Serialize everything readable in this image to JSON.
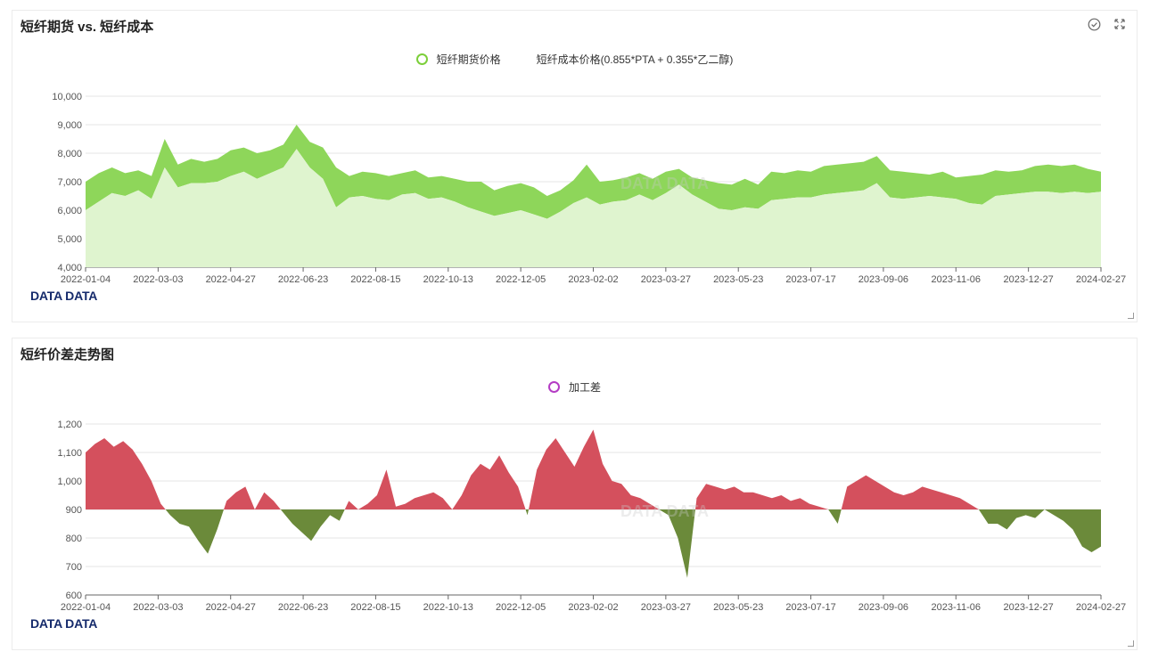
{
  "brand": "DATA DATA",
  "watermark": "DATA DATA",
  "panel1": {
    "title": "短纤期货 vs. 短纤成本",
    "legend": [
      "短纤期货价格",
      "短纤成本价格(0.855*PTA + 0.355*乙二醇)"
    ]
  },
  "panel2": {
    "title": "短纤价差走势图",
    "legend": [
      "加工差"
    ]
  },
  "chart_data": [
    {
      "type": "area",
      "title": "短纤期货 vs. 短纤成本",
      "ylim": [
        4000,
        10000
      ],
      "yticks": [
        4000,
        5000,
        6000,
        7000,
        8000,
        9000,
        10000
      ],
      "ytick_labels": [
        "4,000",
        "5,000",
        "6,000",
        "7,000",
        "8,000",
        "9,000",
        "10,000"
      ],
      "x_tick_labels": [
        "2022-01-04",
        "2022-03-03",
        "2022-04-27",
        "2022-06-23",
        "2022-08-15",
        "2022-10-13",
        "2022-12-05",
        "2023-02-02",
        "2023-03-27",
        "2023-05-23",
        "2023-07-17",
        "2023-09-06",
        "2023-11-06",
        "2023-12-27",
        "2024-02-27"
      ],
      "grid": true,
      "legend_position": "top-center",
      "colors": {
        "futures": "#8ed65a",
        "cost": "#dff4cf",
        "legend_ring": "#7ccf3a"
      },
      "series": [
        {
          "name": "短纤期货价格",
          "values": [
            7000,
            7300,
            7500,
            7300,
            7400,
            7200,
            8500,
            7600,
            7800,
            7700,
            7800,
            8100,
            8200,
            8000,
            8100,
            8300,
            9000,
            8400,
            8200,
            7500,
            7200,
            7350,
            7300,
            7200,
            7300,
            7400,
            7150,
            7200,
            7100,
            7000,
            7000,
            6700,
            6850,
            6950,
            6800,
            6500,
            6700,
            7050,
            7600,
            7000,
            7050,
            7150,
            7300,
            7100,
            7350,
            7450,
            7150,
            7050,
            6950,
            6900,
            7100,
            6900,
            7350,
            7300,
            7400,
            7350,
            7550,
            7600,
            7650,
            7700,
            7900,
            7400,
            7350,
            7300,
            7250,
            7350,
            7150,
            7200,
            7250,
            7400,
            7350,
            7400,
            7550,
            7600,
            7550,
            7600,
            7450,
            7350
          ]
        },
        {
          "name": "短纤成本价格(0.855*PTA + 0.355*乙二醇)",
          "values": [
            6000,
            6300,
            6600,
            6500,
            6700,
            6400,
            7500,
            6800,
            6950,
            6950,
            7000,
            7200,
            7350,
            7100,
            7300,
            7500,
            8150,
            7500,
            7100,
            6100,
            6450,
            6500,
            6400,
            6350,
            6550,
            6600,
            6400,
            6450,
            6300,
            6100,
            5950,
            5800,
            5900,
            6000,
            5850,
            5700,
            5950,
            6250,
            6450,
            6200,
            6300,
            6350,
            6550,
            6350,
            6600,
            6900,
            6550,
            6300,
            6050,
            6000,
            6100,
            6050,
            6350,
            6400,
            6450,
            6450,
            6550,
            6600,
            6650,
            6700,
            6950,
            6450,
            6400,
            6450,
            6500,
            6450,
            6400,
            6250,
            6200,
            6500,
            6550,
            6600,
            6650,
            6650,
            6600,
            6650,
            6600,
            6650
          ]
        }
      ]
    },
    {
      "type": "area",
      "title": "短纤价差走势图",
      "baseline": 900,
      "ylim": [
        600,
        1200
      ],
      "yticks": [
        600,
        700,
        800,
        900,
        1000,
        1100,
        1200
      ],
      "ytick_labels": [
        "600",
        "700",
        "800",
        "900",
        "1,000",
        "1,100",
        "1,200"
      ],
      "x_tick_labels": [
        "2022-01-04",
        "2022-03-03",
        "2022-04-27",
        "2022-06-23",
        "2022-08-15",
        "2022-10-13",
        "2022-12-05",
        "2023-02-02",
        "2023-03-27",
        "2023-05-23",
        "2023-07-17",
        "2023-09-06",
        "2023-11-06",
        "2023-12-27",
        "2024-02-27"
      ],
      "grid": true,
      "legend_position": "top-center",
      "colors": {
        "above": "#d4505d",
        "below": "#6b8a3a",
        "legend_ring": "#b43cc4"
      },
      "series": [
        {
          "name": "加工差",
          "values": [
            1100,
            1130,
            1150,
            1120,
            1140,
            1110,
            1060,
            1000,
            920,
            880,
            850,
            840,
            790,
            745,
            830,
            930,
            960,
            980,
            900,
            960,
            930,
            890,
            850,
            820,
            790,
            840,
            880,
            860,
            930,
            900,
            920,
            950,
            1040,
            910,
            920,
            940,
            950,
            960,
            940,
            900,
            950,
            1020,
            1060,
            1040,
            1090,
            1030,
            980,
            880,
            1040,
            1110,
            1150,
            1100,
            1050,
            1120,
            1180,
            1060,
            1000,
            990,
            950,
            940,
            920,
            900,
            880,
            800,
            660,
            940,
            990,
            980,
            970,
            980,
            960,
            960,
            950,
            940,
            950,
            930,
            940,
            920,
            910,
            900,
            850,
            980,
            1000,
            1020,
            1000,
            980,
            960,
            950,
            960,
            980,
            970,
            960,
            950,
            940,
            920,
            900,
            850,
            850,
            830,
            870,
            880,
            870,
            900,
            880,
            860,
            830,
            770,
            750,
            770
          ]
        }
      ]
    }
  ]
}
